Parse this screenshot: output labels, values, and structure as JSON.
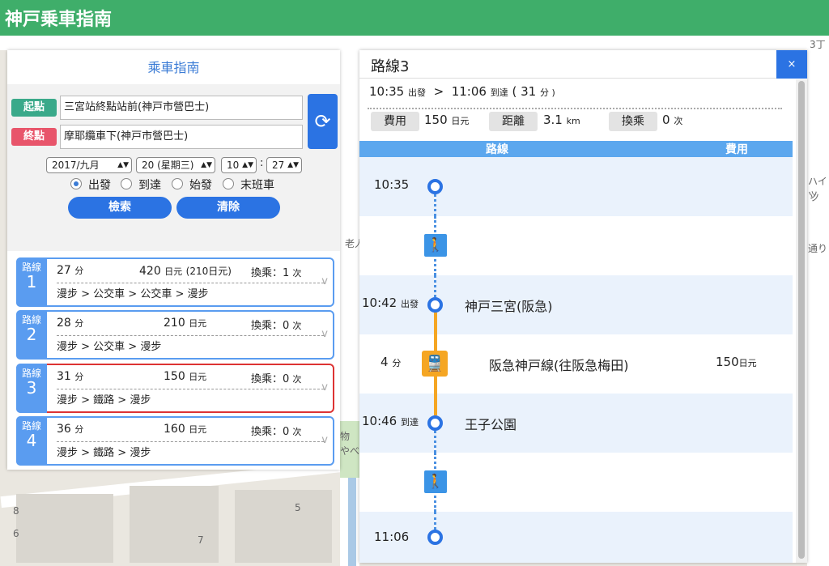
{
  "app": {
    "title": "神戸乗車指南"
  },
  "map": {
    "labels": [
      "3丁",
      "ハイツ",
      "ツ",
      "通り",
      "老人",
      "物",
      "やべ",
      "8",
      "6",
      "7",
      "5"
    ]
  },
  "search": {
    "title": "乘車指南",
    "origin_label": "起點",
    "origin_value": "三宮站終點站前(神戸市營巴士)",
    "dest_label": "終點",
    "dest_value": "摩耶纜車下(神戸市營巴士)",
    "date_value": "2017/九月",
    "day_value": "20 (星期三)",
    "hour_value": "10",
    "minute_value": "27",
    "time_separator": ":",
    "modes": [
      {
        "label": "出發",
        "selected": true
      },
      {
        "label": "到達",
        "selected": false
      },
      {
        "label": "始發",
        "selected": false
      },
      {
        "label": "末班車",
        "selected": false
      }
    ],
    "search_label": "檢索",
    "clear_label": "清除",
    "swap_icon": "swap-icon"
  },
  "routes": [
    {
      "tab": "路線",
      "num": "1",
      "mins": "27",
      "min_unit": "分",
      "fare": "420",
      "fare_unit": "日元",
      "fare_extra": "(210日元)",
      "transfer": "換乘：1",
      "transfer_unit": "次",
      "path": "漫步 > 公交車 > 公交車 > 漫步",
      "chev": "v"
    },
    {
      "tab": "路線",
      "num": "2",
      "mins": "28",
      "min_unit": "分",
      "fare": "210",
      "fare_unit": "日元",
      "fare_extra": "",
      "transfer": "換乘：0",
      "transfer_unit": "次",
      "path": "漫步 > 公交車 > 漫步",
      "chev": "v"
    },
    {
      "tab": "路線",
      "num": "3",
      "mins": "31",
      "min_unit": "分",
      "fare": "150",
      "fare_unit": "日元",
      "fare_extra": "",
      "transfer": "換乘：0",
      "transfer_unit": "次",
      "path": "漫步 > 鐵路 > 漫步",
      "chev": "v"
    },
    {
      "tab": "路線",
      "num": "4",
      "mins": "36",
      "min_unit": "分",
      "fare": "160",
      "fare_unit": "日元",
      "fare_extra": "",
      "transfer": "換乘：0",
      "transfer_unit": "次",
      "path": "漫步 > 鐵路 > 漫步",
      "chev": "v"
    }
  ],
  "detail": {
    "title": "路線3",
    "close": "×",
    "depart_time": "10:35",
    "depart_word": "出發",
    "arrow": ">",
    "arrive_time": "11:06",
    "arrive_word": "到達",
    "duration": "( 31",
    "duration_unit": "分 )",
    "fare_chip": "費用",
    "fare_val": "150",
    "fare_unit": "日元",
    "dist_chip": "距離",
    "dist_val": "3.1",
    "dist_unit": "km",
    "xfer_chip": "換乘",
    "xfer_val": "0",
    "xfer_unit": "次",
    "col_route": "路線",
    "col_fare": "費用",
    "steps": [
      {
        "time": "10:35"
      },
      {
        "icon": "walk-icon",
        "glyph": "🚶"
      },
      {
        "time": "10:42",
        "tag": "出發",
        "station": "神戸三宮(阪急)"
      },
      {
        "mins": "4",
        "min_unit": "分",
        "icon": "train-icon",
        "glyph": "🚆",
        "line": "阪急神戸線(往阪急梅田)",
        "fare": "150",
        "fare_unit": "日元"
      },
      {
        "time": "10:46",
        "tag": "到達",
        "station": "王子公園"
      },
      {
        "icon": "walk-icon",
        "glyph": "🚶"
      },
      {
        "time": "11:06"
      }
    ]
  }
}
